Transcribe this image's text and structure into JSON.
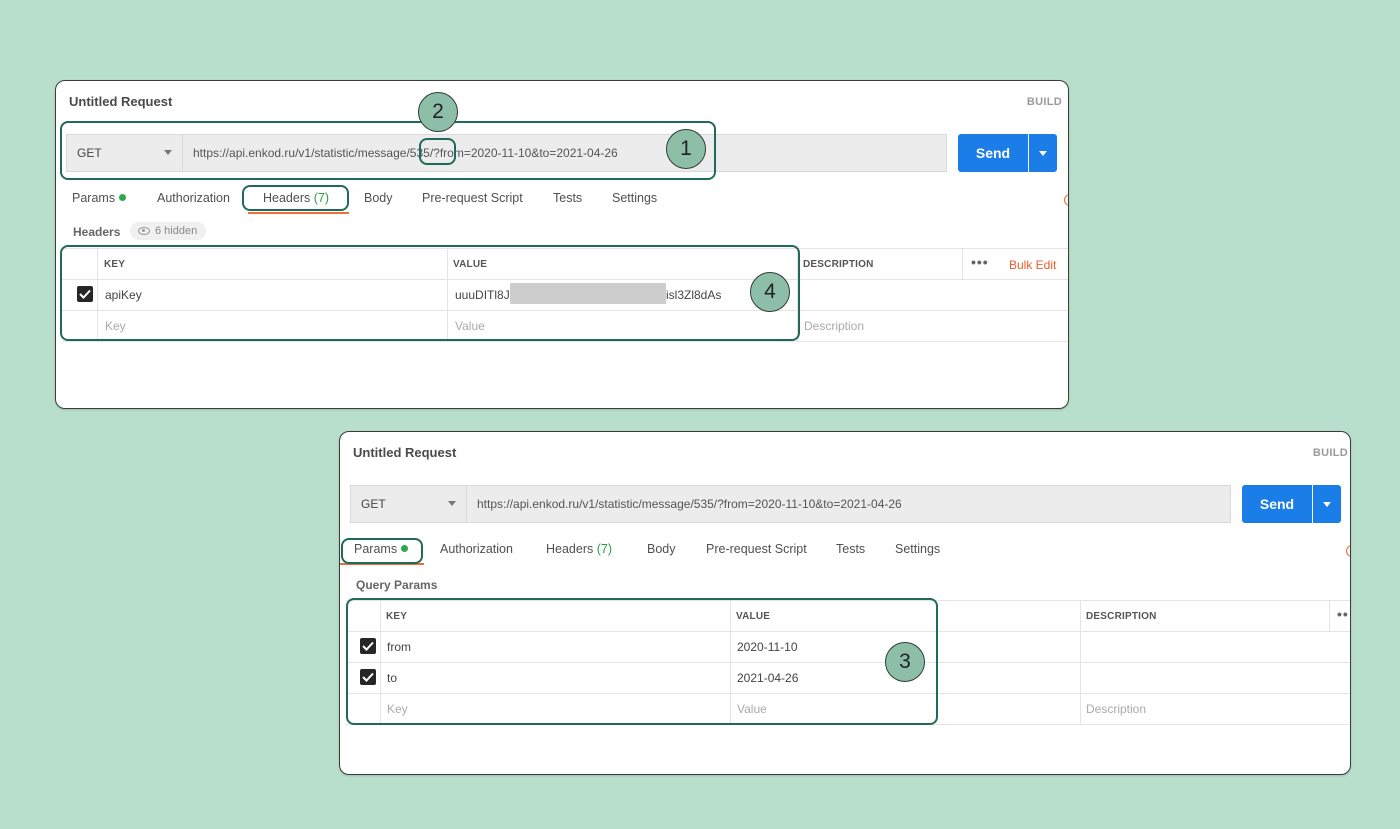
{
  "top_panel": {
    "title": "Untitled Request",
    "build_label": "BUILD",
    "method": "GET",
    "url_prefix": "https://api.enkod.ru/v1/statistic/message/",
    "url_id": "535",
    "url_slash": "/",
    "url_query": "?from=2020-11-10&to=2021-04-26",
    "send_label": "Send",
    "tabs": {
      "params": "Params",
      "authorization": "Authorization",
      "headers": "Headers",
      "headers_count": "(7)",
      "body": "Body",
      "prerequest": "Pre-request Script",
      "tests": "Tests",
      "settings": "Settings"
    },
    "section_label": "Headers",
    "hidden_label": "6 hidden",
    "columns": {
      "key": "KEY",
      "value": "VALUE",
      "description": "DESCRIPTION"
    },
    "bulk_edit": "Bulk Edit",
    "more": "•••",
    "rows": [
      {
        "key": "apiKey",
        "value_start": "uuuDITl8J",
        "value_end": "isl3Zl8dAs",
        "description": "",
        "checked": true
      }
    ],
    "placeholders": {
      "key": "Key",
      "value": "Value",
      "description": "Description"
    }
  },
  "bottom_panel": {
    "title": "Untitled Request",
    "build_label": "BUILD",
    "method": "GET",
    "url": "https://api.enkod.ru/v1/statistic/message/535/?from=2020-11-10&to=2021-04-26",
    "send_label": "Send",
    "tabs": {
      "params": "Params",
      "authorization": "Authorization",
      "headers": "Headers",
      "headers_count": "(7)",
      "body": "Body",
      "prerequest": "Pre-request Script",
      "tests": "Tests",
      "settings": "Settings"
    },
    "section_label": "Query Params",
    "columns": {
      "key": "KEY",
      "value": "VALUE",
      "description": "DESCRIPTION"
    },
    "more": "••",
    "rows": [
      {
        "key": "from",
        "value": "2020-11-10",
        "checked": true
      },
      {
        "key": "to",
        "value": "2021-04-26",
        "checked": true
      }
    ],
    "placeholders": {
      "key": "Key",
      "value": "Value",
      "description": "Description"
    }
  },
  "callouts": {
    "one": "1",
    "two": "2",
    "three": "3",
    "four": "4"
  },
  "colors": {
    "background": "#b7dfcc",
    "send_button": "#1a7de8",
    "highlight_border": "#1f6b57",
    "badge_fill": "#8dbfa8",
    "active_tab_underline": "#f26b3a",
    "status_dot": "#2ea84b",
    "bulk_edit": "#e85d2e"
  }
}
